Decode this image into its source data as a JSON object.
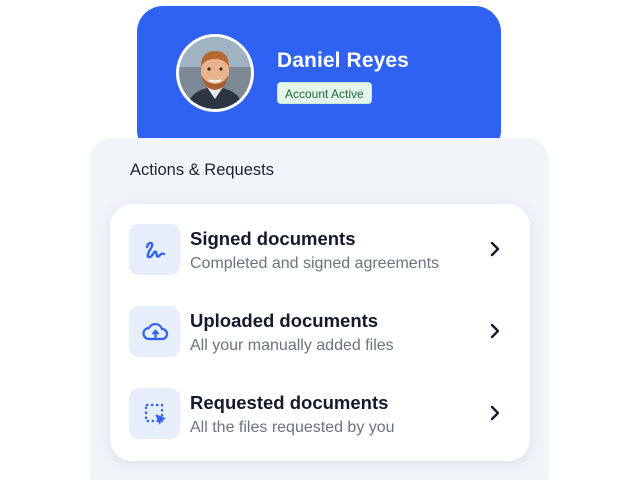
{
  "profile": {
    "name": "Daniel Reyes",
    "status": "Account Active",
    "accent_color": "#2f62f2",
    "avatar_icon": "user-photo"
  },
  "panel": {
    "title": "Actions & Requests"
  },
  "items": [
    {
      "title": "Signed documents",
      "subtitle": "Completed and signed agreements",
      "icon": "signature-icon"
    },
    {
      "title": "Uploaded documents",
      "subtitle": "All your manually added files",
      "icon": "cloud-upload-icon"
    },
    {
      "title": "Requested documents",
      "subtitle": "All the files requested by you",
      "icon": "select-cursor-icon"
    }
  ]
}
